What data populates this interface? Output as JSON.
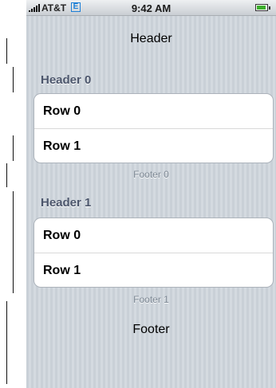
{
  "status_bar": {
    "carrier": "AT&T",
    "network_icon": "E",
    "time": "9:42 AM",
    "battery_icon": "battery-icon"
  },
  "table": {
    "header": "Header",
    "footer": "Footer",
    "sections": [
      {
        "header": "Header 0",
        "rows": [
          "Row 0",
          "Row 1"
        ],
        "footer": "Footer 0"
      },
      {
        "header": "Header 1",
        "rows": [
          "Row 0",
          "Row 1"
        ],
        "footer": "Footer 1"
      }
    ]
  }
}
